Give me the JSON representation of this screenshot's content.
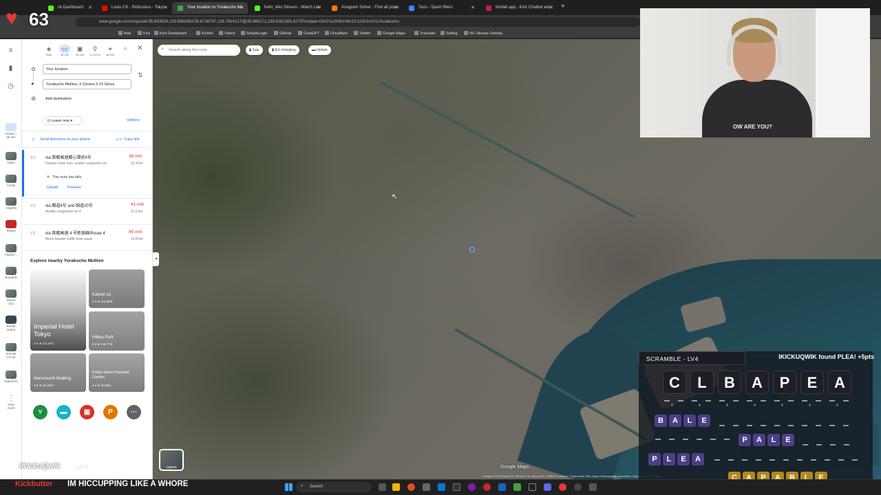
{
  "stream_overlay": {
    "heart_count": "63",
    "chat_user": "iKickuQwik",
    "chat_user_faded": "plea",
    "taskbar_user": "Kickbutter",
    "taskbar_message": "IM HICCUPPING LIKE A WHORE"
  },
  "browser": {
    "tabs": [
      {
        "label": "ck Dashboard"
      },
      {
        "label": "Louis CK - Ridiculous - Tokyo"
      },
      {
        "label": "Your location to Yurakucho Mu"
      },
      {
        "label": "hello_kiko Stream - Watch Live"
      },
      {
        "label": "Anagram Solver - Find all possi"
      },
      {
        "label": "Tazo - Spam filters"
      },
      {
        "label": "Kicklet.app - Kick Chatbot and"
      }
    ],
    "url": "www.google.com/maps/dir/35.693926,139.6959362/35.6736797,139.7624127/@35.685172,139.6261383,42797m/data=!3m2!1e3!4b1!4m11!1m5!1m1!1sYurakucho",
    "bookmarks": [
      "Mail",
      "Kick",
      "Kick Dashboard",
      "Kicklet",
      "Twitch",
      "SimpleLogin",
      "GitHub",
      "ChatGPT",
      "Cloudflare",
      "Twitter",
      "Google Maps",
      "Translate",
      "Selling",
      "IRL Stream Overlay"
    ]
  },
  "maps": {
    "left_strip": {
      "recents": [
        {
          "label": "Yuraku... 36 min"
        },
        {
          "label": "Tokyo"
        },
        {
          "label": "Austin"
        },
        {
          "label": "Angeles"
        },
        {
          "label": "Taiwan"
        },
        {
          "label": "Vladivo..."
        },
        {
          "label": "Bangkok"
        },
        {
          "label": "Davao City"
        },
        {
          "label": "Rhode Island"
        },
        {
          "label": "Suzuka Circuit"
        },
        {
          "label": "Gigharbor"
        },
        {
          "label": "View more"
        }
      ]
    },
    "modes": [
      {
        "label": "Best",
        "icon": "diamond-icon"
      },
      {
        "label": "36 min",
        "icon": "car-icon"
      },
      {
        "label": "36 min",
        "icon": "train-icon"
      },
      {
        "label": "1 h 29 m",
        "icon": "walk-icon"
      },
      {
        "label": "46 min",
        "icon": "bike-icon"
      },
      {
        "label": "",
        "icon": "flight-icon"
      }
    ],
    "origin": "Your location",
    "destination": "Yurakucho Mullion, 3 Chome-2-15 Ginza",
    "add_destination": "Add destination",
    "leave_now": "Leave now",
    "options": "Options",
    "send_directions": "Send directions to your phone",
    "copy_link": "Copy link",
    "routes": [
      {
        "via": "via 首都高速都心環状4号",
        "time": "36 min",
        "detail": "Fastest route now, avoids congestion on",
        "distance": "12.4 km",
        "warning": "This route has tolls.",
        "details_link": "Details",
        "preview_link": "Preview"
      },
      {
        "via": "via 都道4号 and 国道20号",
        "time": "41 min",
        "detail": "Avoids congestion on 4",
        "distance": "11.0 km"
      },
      {
        "via": "via 首都高速 4 号新宿線/Route 4",
        "time": "45 min",
        "detail": "Much heavier traffic than usual",
        "distance": "13.8 km"
      }
    ],
    "explore_title": "Explore nearby Yurakucho Mullion",
    "places": [
      {
        "name": "Imperial Hotel Tokyo",
        "meta": "4.5 ★ (12,447)"
      },
      {
        "name": "Kabuki-za",
        "meta": "4.3 ★ (16,383)"
      },
      {
        "name": "Hibiya Park",
        "meta": "4.3 ★ (16,774)"
      },
      {
        "name": "Marunouchi Building",
        "meta": "4.0 ★ (11,567)"
      },
      {
        "name": "Kokyo Gaien National Garden",
        "meta": "4.4 ★ (9,492)"
      }
    ],
    "quick_actions": [
      {
        "icon": "restaurant-icon",
        "color": "#1e8e3e"
      },
      {
        "icon": "hotel-icon",
        "color": "#12b5cb"
      },
      {
        "icon": "atm-icon",
        "color": "#d93025"
      },
      {
        "icon": "parking-icon",
        "color": "#e37400"
      },
      {
        "icon": "more-icon",
        "color": "#5f6368"
      }
    ],
    "map_search_placeholder": "Search along the route",
    "chips": [
      "Gas",
      "EV charging",
      "Hotels"
    ],
    "layers_label": "Layers",
    "logo": "Google Maps",
    "attribution": "Imagery ©2024 Data SIO, NOAA, U.S. Navy, NGA, GEBCO, Landsat / Copernicus, Data Japan Hydrographic Association, Map data ©2024 Google"
  },
  "scramble": {
    "header": "SCRAMBLE - LV4",
    "found": "IKICKUQWIK found PLEA! +5pts",
    "letters": [
      "C",
      "L",
      "B",
      "A",
      "P",
      "E",
      "A"
    ],
    "letter_scores": [
      "4",
      "4",
      "4",
      "4",
      "4",
      "4",
      "4"
    ],
    "row_bale": [
      "B",
      "A",
      "L",
      "E"
    ],
    "row_pale": [
      "P",
      "A",
      "L",
      "E"
    ],
    "row_plea": [
      "P",
      "L",
      "E",
      "A"
    ],
    "row_capable": [
      "C",
      "A",
      "P",
      "A",
      "B",
      "L",
      "E"
    ],
    "row_numbers": [
      "5",
      "5",
      "6",
      "5",
      "5",
      "5",
      "5",
      "7"
    ]
  },
  "taskbar": {
    "search": "Search"
  }
}
